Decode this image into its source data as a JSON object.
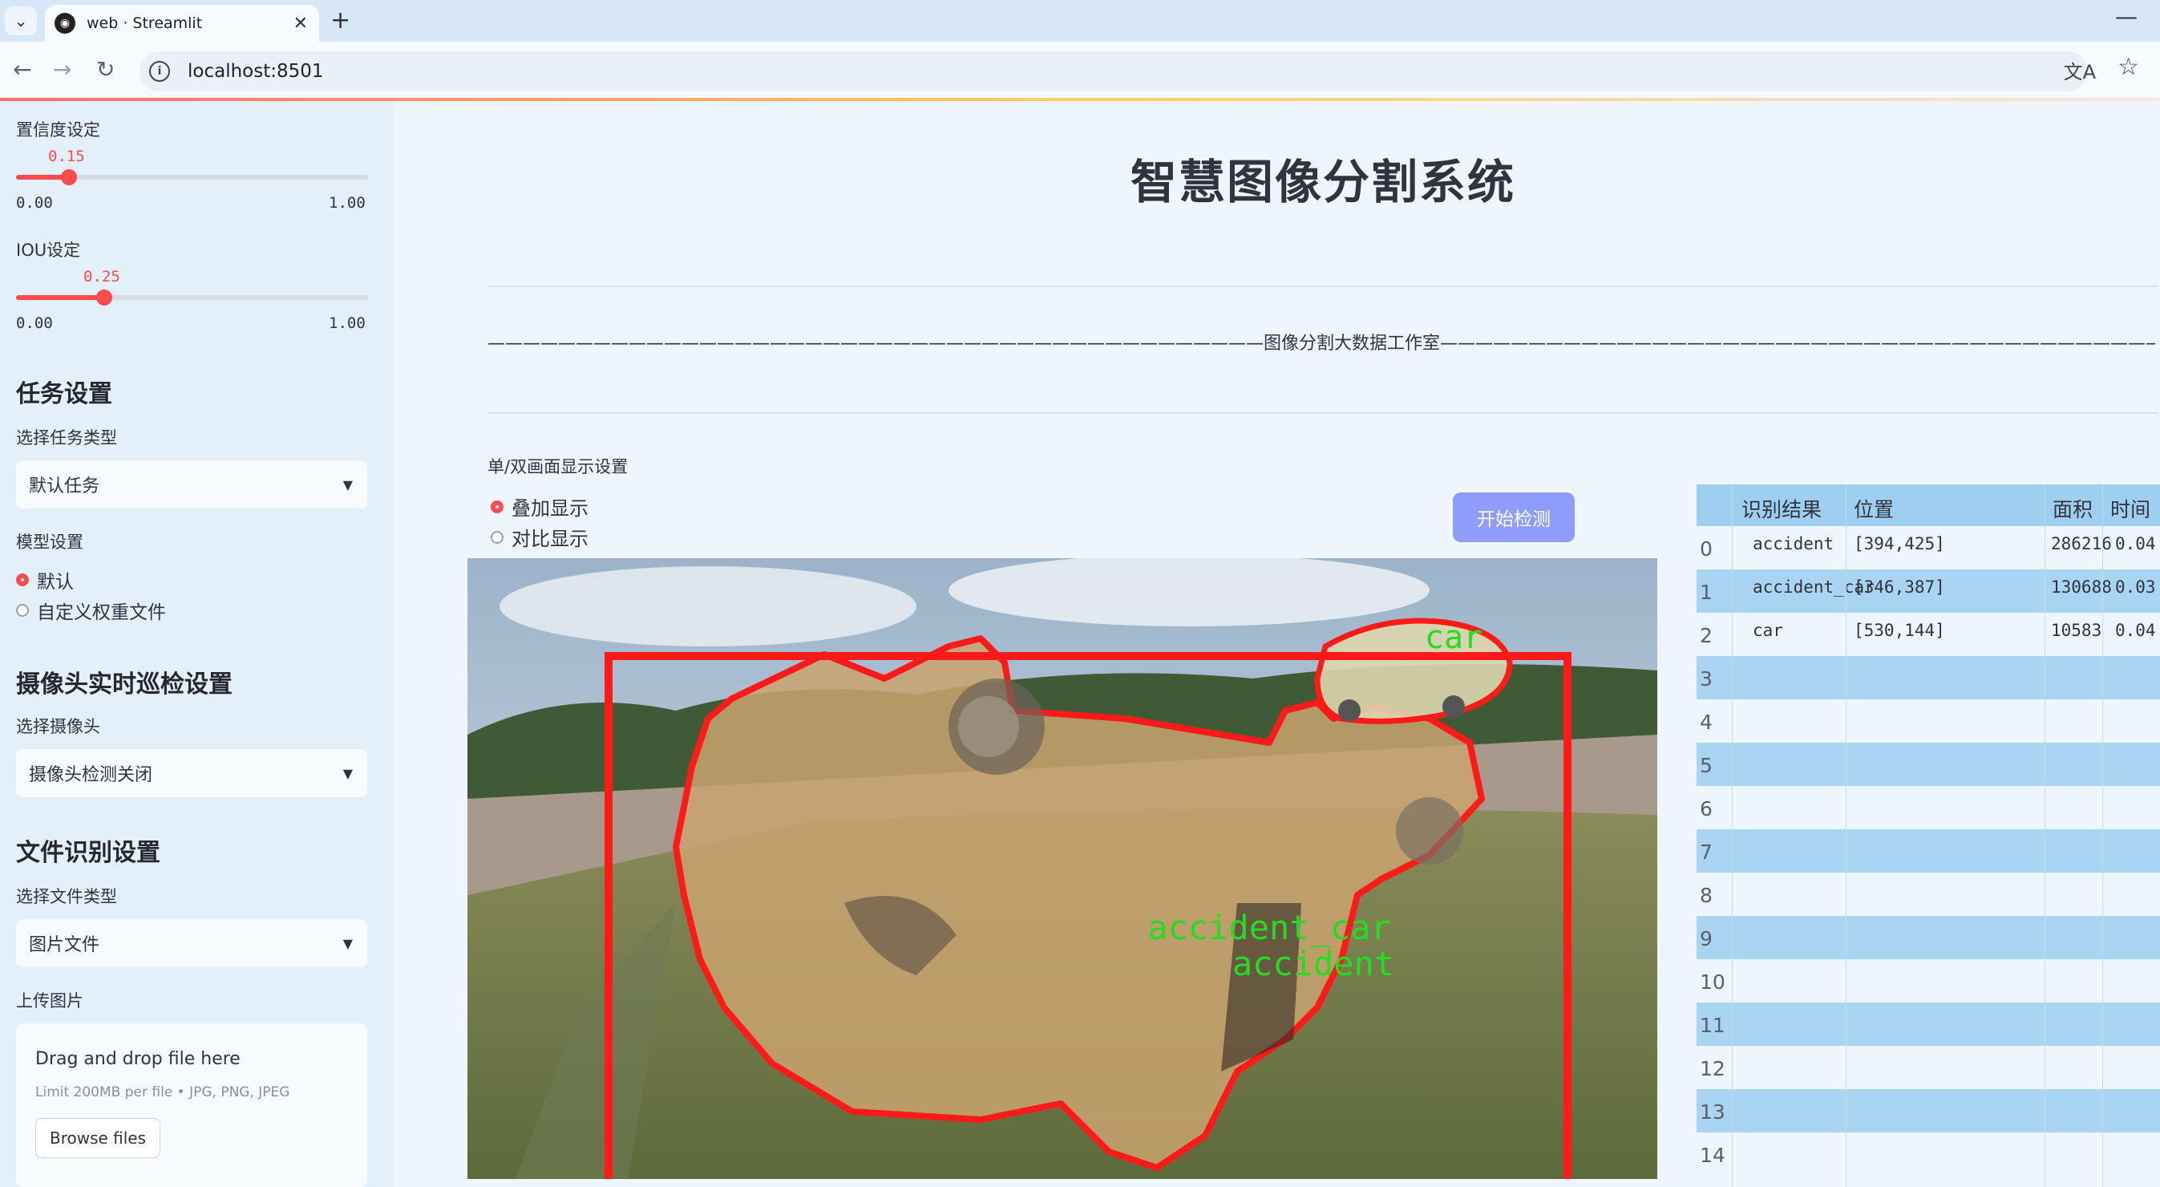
{
  "browser": {
    "tab_title": "web · Streamlit",
    "tab_icon": "streamlit-icon",
    "close_glyph": "✕",
    "new_tab_glyph": "+",
    "minimize_glyph": "—",
    "url": "localhost:8501"
  },
  "sidebar": {
    "confidence": {
      "label": "置信度设定",
      "value": "0.15",
      "value_fraction": 0.15,
      "min": "0.00",
      "max": "1.00"
    },
    "iou": {
      "label": "IOU设定",
      "value": "0.25",
      "value_fraction": 0.25,
      "min": "0.00",
      "max": "1.00"
    },
    "task_section": {
      "heading": "任务设置",
      "label": "选择任务类型",
      "selected": "默认任务"
    },
    "model_section": {
      "label": "模型设置",
      "options": [
        "默认",
        "自定义权重文件"
      ],
      "selected_index": 0
    },
    "camera_section": {
      "heading": "摄像头实时巡检设置",
      "label": "选择摄像头",
      "selected": "摄像头检测关闭"
    },
    "file_section": {
      "heading": "文件识别设置",
      "label": "选择文件类型",
      "selected": "图片文件"
    },
    "upload": {
      "label": "上传图片",
      "drag_text": "Drag and drop file here",
      "limit_text": "Limit 200MB per file • JPG, PNG, JPEG",
      "button": "Browse files"
    }
  },
  "main": {
    "title": "智慧图像分割系统",
    "subtitle_line": "————————————————————————————————————————————图像分割大数据工作室————————————————————————————————————————————",
    "display_label": "单/双画面显示设置",
    "display_options": [
      "叠加显示",
      "对比显示"
    ],
    "display_selected_index": 0,
    "start_button": "开始检测",
    "detections": [
      {
        "label": "car"
      },
      {
        "label": "accident_car"
      },
      {
        "label": "accident"
      }
    ]
  },
  "table": {
    "headers": [
      "识别结果",
      "位置",
      "面积",
      "时间"
    ],
    "rows": [
      {
        "idx": "0",
        "result": "accident",
        "pos": "[394,425]",
        "area": "286216",
        "time": "0.04"
      },
      {
        "idx": "1",
        "result": "accident_car",
        "pos": "[346,387]",
        "area": "130688",
        "time": "0.03"
      },
      {
        "idx": "2",
        "result": "car",
        "pos": "[530,144]",
        "area": "10583",
        "time": "0.04"
      },
      {
        "idx": "3"
      },
      {
        "idx": "4"
      },
      {
        "idx": "5"
      },
      {
        "idx": "6"
      },
      {
        "idx": "7"
      },
      {
        "idx": "8"
      },
      {
        "idx": "9"
      },
      {
        "idx": "10"
      },
      {
        "idx": "11"
      },
      {
        "idx": "12"
      },
      {
        "idx": "13"
      },
      {
        "idx": "14"
      }
    ]
  },
  "colors": {
    "accent": "#ff4b4b",
    "button": "#8f9dfa",
    "mask_outline": "#ff1a1a",
    "label_text": "#22dd22"
  }
}
